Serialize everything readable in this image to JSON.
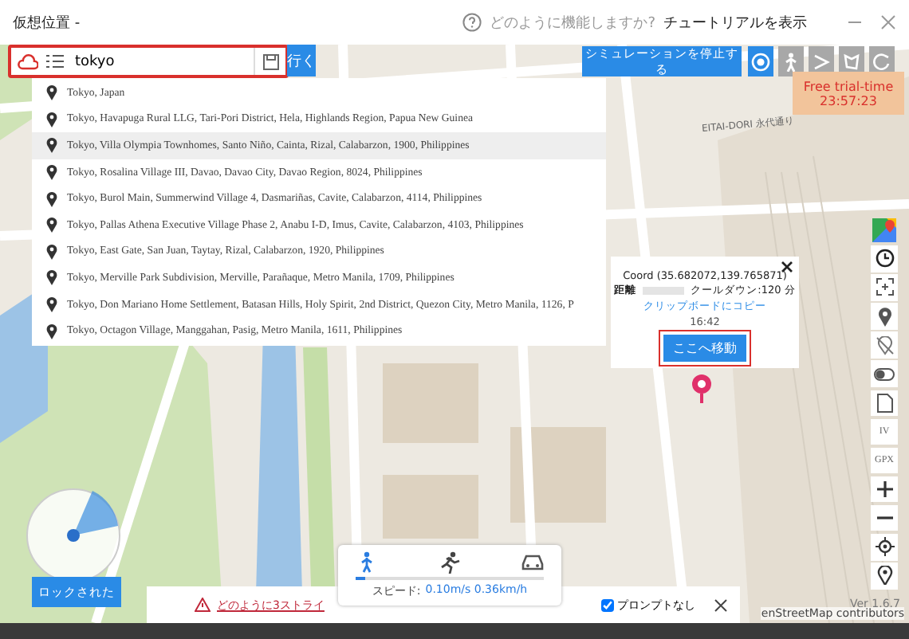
{
  "window": {
    "title": "仮想位置 -",
    "help_question": "どのように機能しますか?",
    "help_link": "チュートリアルを表示"
  },
  "search": {
    "value": "tokyo",
    "go_button": "行く"
  },
  "suggestions": [
    {
      "text": "Tokyo, Japan",
      "selected": false
    },
    {
      "text": "Tokyo, Havapuga Rural LLG, Tari-Pori District, Hela, Highlands Region, Papua New Guinea",
      "selected": false
    },
    {
      "text": "Tokyo, Villa Olympia Townhomes, Santo Niño, Cainta, Rizal, Calabarzon, 1900, Philippines",
      "selected": true
    },
    {
      "text": "Tokyo, Rosalina Village III, Davao, Davao City, Davao Region, 8024, Philippines",
      "selected": false
    },
    {
      "text": "Tokyo, Burol Main, Summerwind Village 4, Dasmariñas, Cavite, Calabarzon, 4114, Philippines",
      "selected": false
    },
    {
      "text": "Tokyo, Pallas Athena Executive Village Phase 2, Anabu I-D, Imus, Cavite, Calabarzon, 4103, Philippines",
      "selected": false
    },
    {
      "text": "Tokyo, East Gate, San Juan, Taytay, Rizal, Calabarzon, 1920, Philippines",
      "selected": false
    },
    {
      "text": "Tokyo, Merville Park Subdivision, Merville, Parañaque, Metro Manila, 1709, Philippines",
      "selected": false
    },
    {
      "text": "Tokyo, Don Mariano Home Settlement, Batasan Hills, Holy Spirit, 2nd District, Quezon City, Metro Manila, 1126, P",
      "selected": false
    },
    {
      "text": "Tokyo, Octagon Village, Manggahan, Pasig, Metro Manila, 1611, Philippines",
      "selected": false
    }
  ],
  "stop_button": "シミュレーションを停止する",
  "modes": [
    {
      "kind": "teleport",
      "selected": true
    },
    {
      "kind": "walk",
      "selected": false
    },
    {
      "kind": "route",
      "selected": false
    },
    {
      "kind": "multi",
      "selected": false
    },
    {
      "kind": "jump",
      "selected": false
    }
  ],
  "trial": {
    "label": "Free trial-time",
    "time": "23:57:23"
  },
  "map": {
    "street_label": "EITAI-DORI 永代通り",
    "attribution": "enStreetMap contributors",
    "version": "Ver 1.6.7"
  },
  "popup": {
    "coord": "Coord (35.682072,139.765871)",
    "distance_label": "距離",
    "cooldown": "クールダウン:120 分",
    "copy_link": "クリップボードにコピー",
    "time": "16:42",
    "move_button": "ここへ移動"
  },
  "side_tools": [
    {
      "kind": "maps"
    },
    {
      "kind": "history"
    },
    {
      "kind": "crosshair"
    },
    {
      "kind": "pin"
    },
    {
      "kind": "pin-off"
    },
    {
      "kind": "toggle"
    },
    {
      "kind": "file"
    },
    {
      "kind": "text",
      "label": "IV"
    },
    {
      "kind": "text",
      "label": "GPX"
    },
    {
      "kind": "zoom-in"
    },
    {
      "kind": "zoom-out"
    },
    {
      "kind": "locate"
    },
    {
      "kind": "marker"
    }
  ],
  "lock_button": "ロックされた",
  "speed": {
    "modes": [
      {
        "kind": "walk",
        "selected": true
      },
      {
        "kind": "run",
        "selected": false
      },
      {
        "kind": "car",
        "selected": false
      }
    ],
    "label": "スピード:",
    "value": "0.10m/s 0.36km/h",
    "level": 0.05
  },
  "notice": {
    "text": "どのように3ストライ",
    "prompt_label": "プロンプトなし",
    "prompt_checked": true
  }
}
